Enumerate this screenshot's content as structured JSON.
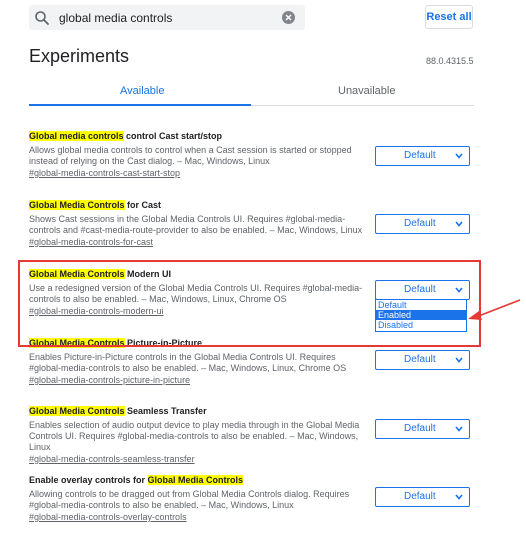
{
  "search": {
    "value": "global media controls"
  },
  "reset_button": "Reset all",
  "title": "Experiments",
  "version": "88.0.4315.5",
  "tabs": [
    {
      "label": "Available",
      "active": true
    },
    {
      "label": "Unavailable",
      "active": false
    }
  ],
  "experiments": [
    {
      "title_highlight": "Global media controls",
      "title_rest": " control Cast start/stop",
      "description": "Allows global media controls to control when a Cast session is started or stopped instead of relying on the Cast dialog. – Mac, Windows, Linux",
      "link": "#global-media-controls-cast-start-stop",
      "select_value": "Default"
    },
    {
      "title_highlight": "Global Media Controls",
      "title_rest": " for Cast",
      "description": "Shows Cast sessions in the Global Media Controls UI. Requires #global-media-controls and #cast-media-route-provider to also be enabled. – Mac, Windows, Linux",
      "link": "#global-media-controls-for-cast",
      "select_value": "Default"
    },
    {
      "title_highlight": "Global Media Controls",
      "title_rest": " Modern UI",
      "description": "Use a redesigned version of the Global Media Controls UI. Requires #global-media-controls to also be enabled. – Mac, Windows, Linux, Chrome OS",
      "link": "#global-media-controls-modern-ui",
      "select_value": "Default"
    },
    {
      "title_highlight": "Global Media Controls",
      "title_rest": " Picture-in-Picture",
      "description": "Enables Picture-in-Picture controls in the Global Media Controls UI. Requires #global-media-controls to also be enabled. – Mac, Windows, Linux, Chrome OS",
      "link": "#global-media-controls-picture-in-picture",
      "select_value": "Default"
    },
    {
      "title_highlight": "Global Media Controls",
      "title_rest": " Seamless Transfer",
      "description": "Enables selection of audio output device to play media through in the Global Media Controls UI. Requires #global-media-controls to also be enabled. – Mac, Windows, Linux",
      "link": "#global-media-controls-seamless-transfer",
      "select_value": "Default"
    },
    {
      "title_prefix": "Enable overlay controls for ",
      "title_highlight": "Global Media Controls",
      "description": "Allowing controls to be dragged out from Global Media Controls dialog. Requires #global-media-controls to also be enabled. – Mac, Windows, Linux",
      "link": "#global-media-controls-overlay-controls",
      "select_value": "Default"
    }
  ],
  "dropdown_options": [
    "Default",
    "Enabled",
    "Disabled"
  ],
  "dropdown_selected": "Enabled",
  "colors": {
    "accent": "#1a73e8",
    "highlight": "#ffff00",
    "annotation_red": "#e53935"
  }
}
